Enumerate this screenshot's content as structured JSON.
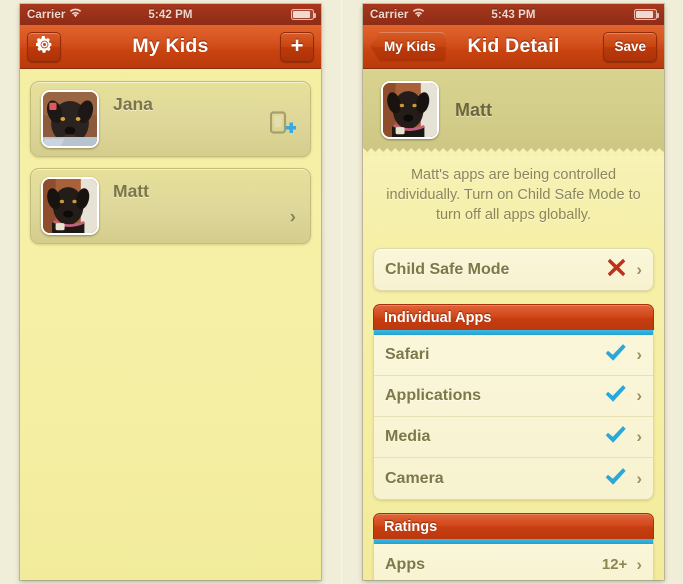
{
  "left_phone": {
    "statusbar": {
      "carrier": "Carrier",
      "time": "5:42 PM",
      "wifi_icon": "wifi-icon",
      "battery_icon": "battery-icon"
    },
    "navbar": {
      "title": "My Kids",
      "settings_icon": "gear-icon",
      "add_label": "+",
      "add_icon": "plus-icon"
    },
    "kids": [
      {
        "name": "Jana",
        "accessory_icon": "device-plus-icon",
        "avatar": "dog-photo-jana"
      },
      {
        "name": "Matt",
        "accessory_icon": "chevron-right-icon",
        "avatar": "dog-photo-matt"
      }
    ]
  },
  "right_phone": {
    "statusbar": {
      "carrier": "Carrier",
      "time": "5:43 PM",
      "wifi_icon": "wifi-icon",
      "battery_icon": "battery-icon"
    },
    "navbar": {
      "back_label": "My Kids",
      "title": "Kid Detail",
      "save_label": "Save"
    },
    "detail": {
      "kid_name": "Matt",
      "avatar": "dog-photo-matt",
      "blurb": "Matt's apps are being controlled individually. Turn on Child Safe Mode to turn off all apps globally."
    },
    "child_safe_mode": {
      "label": "Child Safe Mode",
      "state_icon": "red-x-icon",
      "chevron": "›"
    },
    "sections": [
      {
        "title": "Individual Apps",
        "rows": [
          {
            "label": "Safari",
            "state_icon": "blue-check-icon",
            "chevron": "›"
          },
          {
            "label": "Applications",
            "state_icon": "blue-check-icon",
            "chevron": "›"
          },
          {
            "label": "Media",
            "state_icon": "blue-check-icon",
            "chevron": "›"
          },
          {
            "label": "Camera",
            "state_icon": "blue-check-icon",
            "chevron": "›"
          }
        ]
      },
      {
        "title": "Ratings",
        "rows": [
          {
            "label": "Apps",
            "value": "12+",
            "chevron": "›"
          }
        ]
      }
    ]
  },
  "colors": {
    "nav_orange": "#c8430f",
    "status_bar": "#8e2c16",
    "screen_yellow": "#f5efa4",
    "card_cream": "#faf6da",
    "label_olive": "#7e7848",
    "accent_cyan": "#23a4d4",
    "check_blue": "#29a8dc",
    "x_red": "#c0301a"
  }
}
